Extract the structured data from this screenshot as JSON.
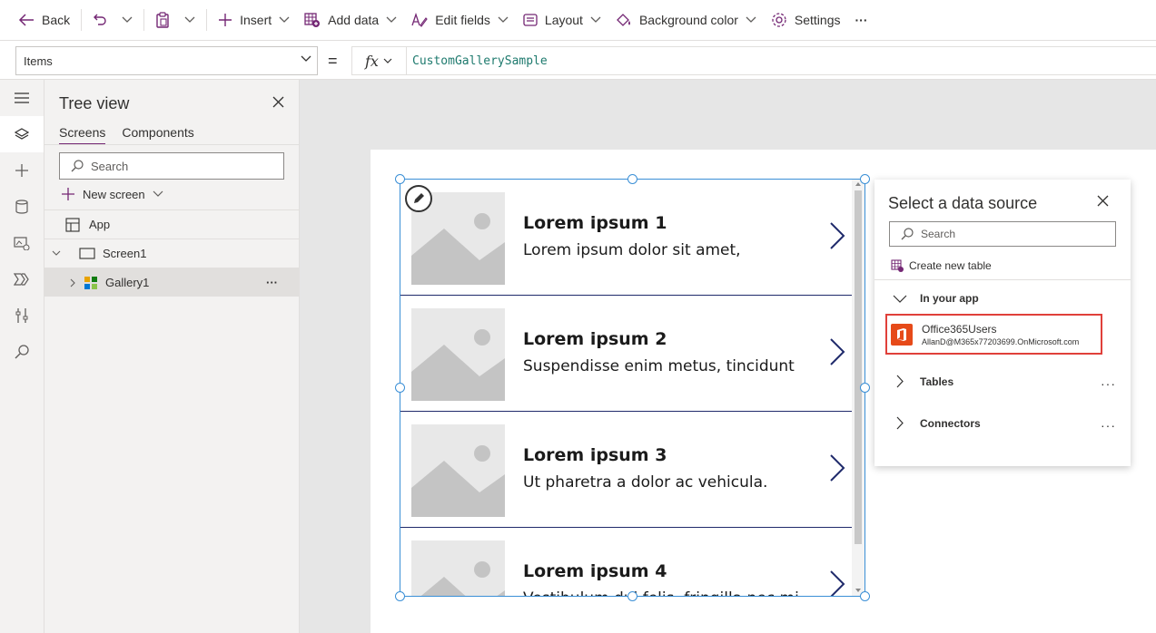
{
  "toolbar": {
    "back": "Back",
    "insert": "Insert",
    "add_data": "Add data",
    "edit_fields": "Edit fields",
    "layout": "Layout",
    "background_color": "Background color",
    "settings": "Settings",
    "more": "···"
  },
  "formula_bar": {
    "property": "Items",
    "equals": "=",
    "fx": "fx",
    "formula": "CustomGallerySample"
  },
  "tree_view": {
    "title": "Tree view",
    "tabs": [
      "Screens",
      "Components"
    ],
    "search_placeholder": "Search",
    "new_screen": "New screen",
    "items": [
      {
        "label": "App"
      },
      {
        "label": "Screen1"
      },
      {
        "label": "Gallery1"
      }
    ],
    "more": "···"
  },
  "gallery": {
    "items": [
      {
        "title": "Lorem ipsum 1",
        "subtitle": "Lorem ipsum dolor sit amet,"
      },
      {
        "title": "Lorem ipsum 2",
        "subtitle": "Suspendisse enim metus, tincidunt"
      },
      {
        "title": "Lorem ipsum 3",
        "subtitle": "Ut pharetra a dolor ac vehicula."
      },
      {
        "title": "Lorem ipsum 4",
        "subtitle": "Vestibulum dui felis, fringilla nec mi"
      }
    ]
  },
  "data_source_panel": {
    "title": "Select a data source",
    "search_placeholder": "Search",
    "create_new_table": "Create new table",
    "in_your_app": "In your app",
    "connection": {
      "name": "Office365Users",
      "account": "AllanD@M365x77203699.OnMicrosoft.com"
    },
    "tables": "Tables",
    "connectors": "Connectors",
    "more": "···"
  },
  "colors": {
    "accent": "#742774",
    "selection": "#3a8fd6",
    "highlight_border": "#e0403a",
    "office_orange": "#e64a19",
    "formula_text": "#1e7a6e"
  }
}
